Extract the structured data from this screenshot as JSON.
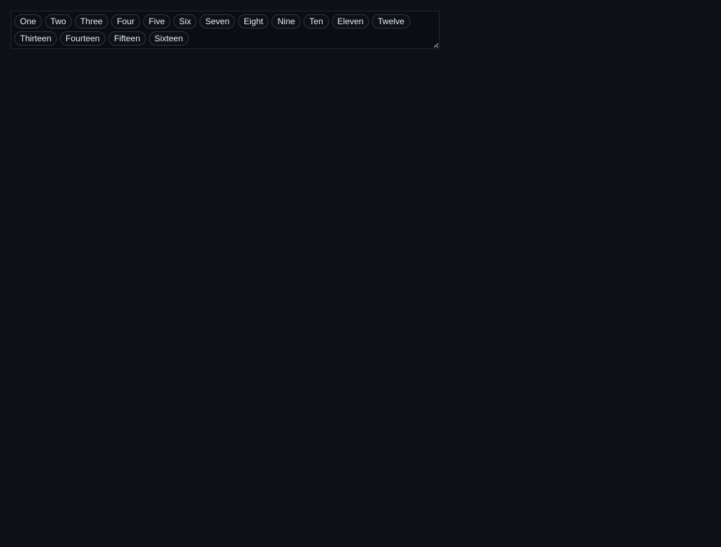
{
  "tags": [
    "One",
    "Two",
    "Three",
    "Four",
    "Five",
    "Six",
    "Seven",
    "Eight",
    "Nine",
    "Ten",
    "Eleven",
    "Twelve",
    "Thirteen",
    "Fourteen",
    "Fifteen",
    "Sixteen"
  ]
}
